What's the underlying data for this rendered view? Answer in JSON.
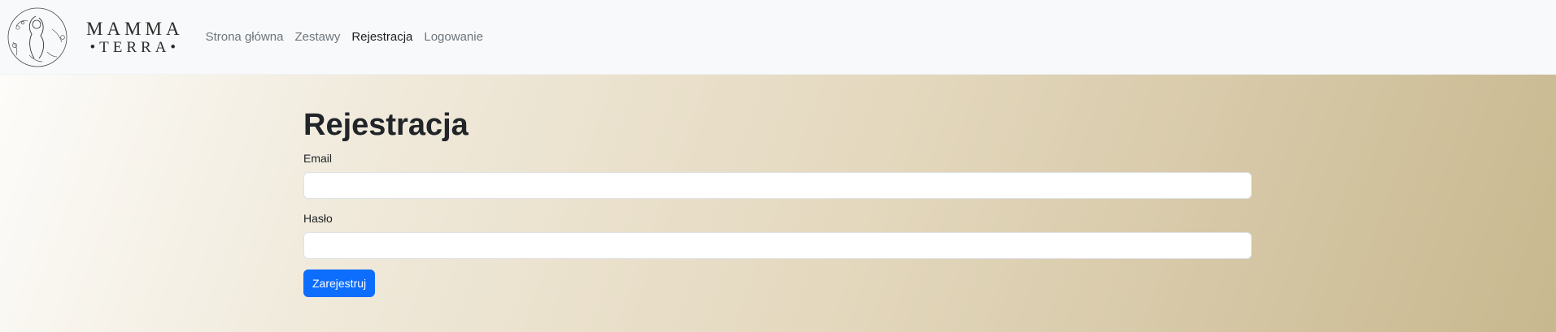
{
  "brand": {
    "line1": "MAMMA",
    "line2": "•TERRA•"
  },
  "nav": {
    "items": [
      {
        "label": "Strona główna"
      },
      {
        "label": "Zestawy"
      },
      {
        "label": "Rejestracja",
        "active": true
      },
      {
        "label": "Logowanie"
      }
    ]
  },
  "page": {
    "title": "Rejestracja"
  },
  "form": {
    "email_label": "Email",
    "email_value": "",
    "password_label": "Hasło",
    "password_value": "",
    "submit_label": "Zarejestruj"
  },
  "colors": {
    "accent": "#0d6efd",
    "navbar_bg": "#f8f9fa",
    "gradient_end": "#c8b88f"
  }
}
